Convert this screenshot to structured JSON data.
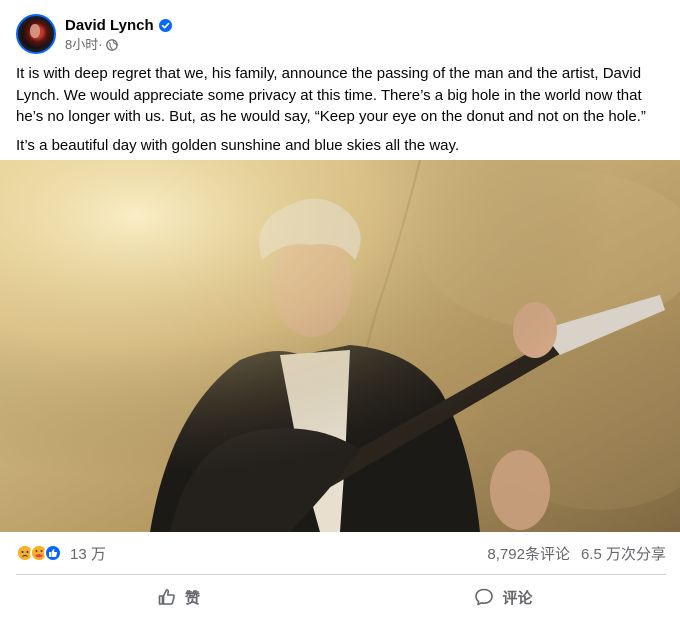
{
  "author": {
    "name": "David Lynch",
    "time": "8小时",
    "time_sep": " ·"
  },
  "post": {
    "paragraphs": [
      "It is with deep regret that we, his family, announce the passing of the man and the artist, David Lynch.  We would appreciate some privacy at this time.  There’s a big hole in the world now that he’s no longer with us.  But, as he would say, “Keep your eye on the donut and not on the hole.”",
      "It’s a beautiful day with golden sunshine and blue skies all the way."
    ]
  },
  "stats": {
    "reactions_count": "13 万",
    "comments": "8,792条评论",
    "shares": "6.5 万次分享"
  },
  "actions": {
    "like_label": "赞",
    "comment_label": "评论"
  },
  "colors": {
    "accent": "#0866ff",
    "secondary_text": "#65676b",
    "divider": "#ced0d4"
  },
  "icons": [
    "verified-badge-icon",
    "globe-icon",
    "sad-reaction-icon",
    "care-reaction-icon",
    "like-reaction-icon",
    "thumbs-up-icon",
    "comment-bubble-icon"
  ]
}
